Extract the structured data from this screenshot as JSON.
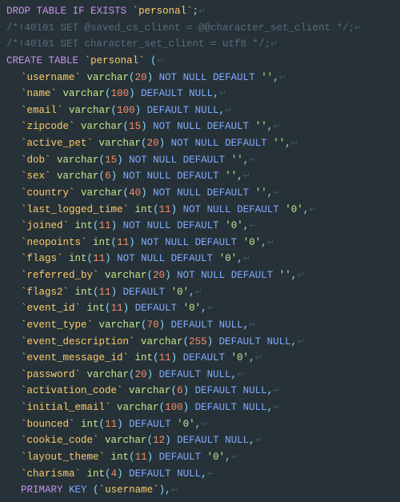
{
  "code": {
    "l0": {
      "kw_drop": "DROP",
      "kw_table": "TABLE",
      "kw_if": "IF",
      "kw_exists": "EXISTS",
      "name": "`personal`",
      "semi": ";"
    },
    "l1": "/*!40101 SET @saved_cs_client     = @@character_set_client */;",
    "l2": "/*!40101 SET character_set_client = utf8 */;",
    "l3": {
      "kw_create": "CREATE",
      "kw_table": "TABLE",
      "name": "`personal`",
      "open": "("
    },
    "cols": [
      {
        "name": "`username`",
        "parts": [
          "varchar",
          "(",
          "20",
          ")",
          " ",
          "NOT",
          " ",
          "NULL",
          " ",
          "DEFAULT",
          " ",
          "''",
          ","
        ]
      },
      {
        "name": "`name`",
        "parts": [
          "varchar",
          "(",
          "100",
          ")",
          " ",
          "DEFAULT",
          " ",
          "NULL",
          ","
        ]
      },
      {
        "name": "`email`",
        "parts": [
          "varchar",
          "(",
          "100",
          ")",
          " ",
          "DEFAULT",
          " ",
          "NULL",
          ","
        ]
      },
      {
        "name": "`zipcode`",
        "parts": [
          "varchar",
          "(",
          "15",
          ")",
          " ",
          "NOT",
          " ",
          "NULL",
          " ",
          "DEFAULT",
          " ",
          "''",
          ","
        ]
      },
      {
        "name": "`active_pet`",
        "parts": [
          "varchar",
          "(",
          "20",
          ")",
          " ",
          "NOT",
          " ",
          "NULL",
          " ",
          "DEFAULT",
          " ",
          "''",
          ","
        ]
      },
      {
        "name": "`dob`",
        "parts": [
          "varchar",
          "(",
          "15",
          ")",
          " ",
          "NOT",
          " ",
          "NULL",
          " ",
          "DEFAULT",
          " ",
          "''",
          ","
        ]
      },
      {
        "name": "`sex`",
        "parts": [
          "varchar",
          "(",
          "6",
          ")",
          " ",
          "NOT",
          " ",
          "NULL",
          " ",
          "DEFAULT",
          " ",
          "''",
          ","
        ]
      },
      {
        "name": "`country`",
        "parts": [
          "varchar",
          "(",
          "40",
          ")",
          " ",
          "NOT",
          " ",
          "NULL",
          " ",
          "DEFAULT",
          " ",
          "''",
          ","
        ]
      },
      {
        "name": "`last_logged_time`",
        "parts": [
          "int",
          "(",
          "11",
          ")",
          " ",
          "NOT",
          " ",
          "NULL",
          " ",
          "DEFAULT",
          " ",
          "'0'",
          ","
        ]
      },
      {
        "name": "`joined`",
        "parts": [
          "int",
          "(",
          "11",
          ")",
          " ",
          "NOT",
          " ",
          "NULL",
          " ",
          "DEFAULT",
          " ",
          "'0'",
          ","
        ]
      },
      {
        "name": "`neopoints`",
        "parts": [
          "int",
          "(",
          "11",
          ")",
          " ",
          "NOT",
          " ",
          "NULL",
          " ",
          "DEFAULT",
          " ",
          "'0'",
          ","
        ]
      },
      {
        "name": "`flags`",
        "parts": [
          "int",
          "(",
          "11",
          ")",
          " ",
          "NOT",
          " ",
          "NULL",
          " ",
          "DEFAULT",
          " ",
          "'0'",
          ","
        ]
      },
      {
        "name": "`referred_by`",
        "parts": [
          "varchar",
          "(",
          "20",
          ")",
          " ",
          "NOT",
          " ",
          "NULL",
          " ",
          "DEFAULT",
          " ",
          "''",
          ","
        ]
      },
      {
        "name": "`flags2`",
        "parts": [
          "int",
          "(",
          "11",
          ")",
          " ",
          "DEFAULT",
          " ",
          "'0'",
          ","
        ]
      },
      {
        "name": "`event_id`",
        "parts": [
          "int",
          "(",
          "11",
          ")",
          " ",
          "DEFAULT",
          " ",
          "'0'",
          ","
        ]
      },
      {
        "name": "`event_type`",
        "parts": [
          "varchar",
          "(",
          "70",
          ")",
          " ",
          "DEFAULT",
          " ",
          "NULL",
          ","
        ]
      },
      {
        "name": "`event_description`",
        "parts": [
          "varchar",
          "(",
          "255",
          ")",
          " ",
          "DEFAULT",
          " ",
          "NULL",
          ","
        ]
      },
      {
        "name": "`event_message_id`",
        "parts": [
          "int",
          "(",
          "11",
          ")",
          " ",
          "DEFAULT",
          " ",
          "'0'",
          ","
        ]
      },
      {
        "name": "`password`",
        "parts": [
          "varchar",
          "(",
          "20",
          ")",
          " ",
          "DEFAULT",
          " ",
          "NULL",
          ","
        ]
      },
      {
        "name": "`activation_code`",
        "parts": [
          "varchar",
          "(",
          "6",
          ")",
          " ",
          "DEFAULT",
          " ",
          "NULL",
          ","
        ]
      },
      {
        "name": "`initial_email`",
        "parts": [
          "varchar",
          "(",
          "100",
          ")",
          " ",
          "DEFAULT",
          " ",
          "NULL",
          ","
        ]
      },
      {
        "name": "`bounced`",
        "parts": [
          "int",
          "(",
          "11",
          ")",
          " ",
          "DEFAULT",
          " ",
          "'0'",
          ","
        ]
      },
      {
        "name": "`cookie_code`",
        "parts": [
          "varchar",
          "(",
          "12",
          ")",
          " ",
          "DEFAULT",
          " ",
          "NULL",
          ","
        ]
      },
      {
        "name": "`layout_theme`",
        "parts": [
          "int",
          "(",
          "11",
          ")",
          " ",
          "DEFAULT",
          " ",
          "'0'",
          ","
        ]
      },
      {
        "name": "`charisma`",
        "parts": [
          "int",
          "(",
          "4",
          ")",
          " ",
          "DEFAULT",
          " ",
          "NULL",
          ","
        ]
      }
    ],
    "pk": {
      "kw_primary": "PRIMARY",
      "kw_key": "KEY",
      "open": "(",
      "col": "`username`",
      "close": ")",
      "comma": ","
    },
    "eol": "↵"
  }
}
